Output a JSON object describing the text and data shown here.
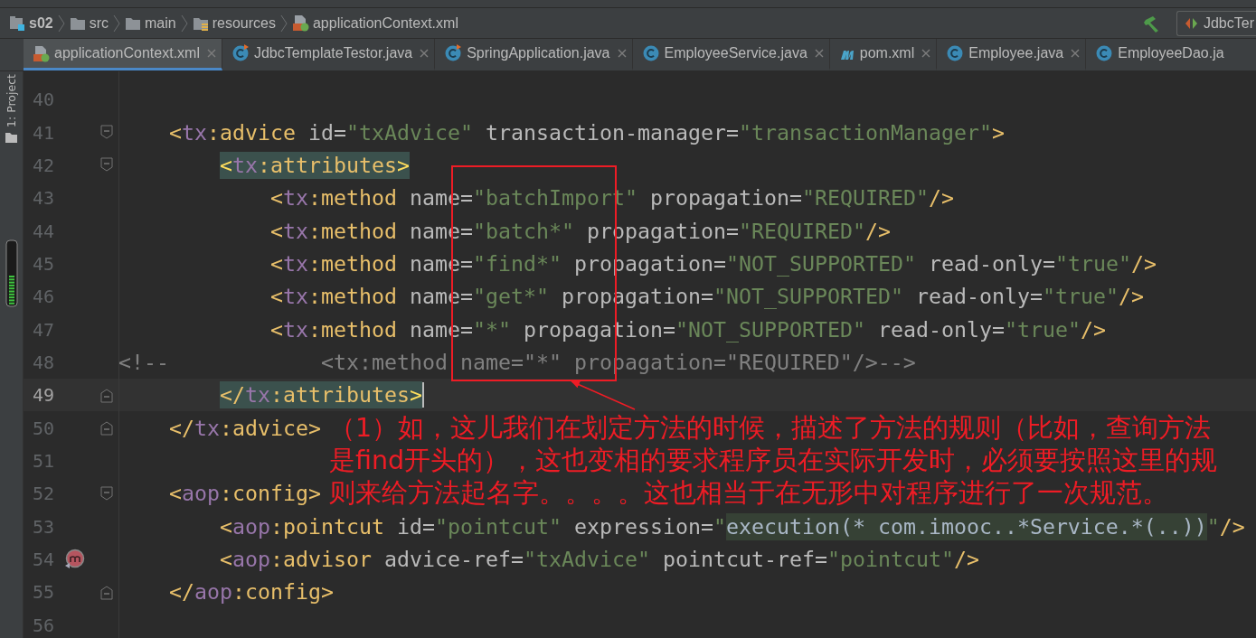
{
  "breadcrumbs": [
    {
      "label": "s02",
      "kind": "module"
    },
    {
      "label": "src",
      "kind": "folder"
    },
    {
      "label": "main",
      "kind": "folder"
    },
    {
      "label": "resources",
      "kind": "resources"
    },
    {
      "label": "applicationContext.xml",
      "kind": "xml"
    }
  ],
  "run_config": {
    "label": "JdbcTer"
  },
  "tool_window": {
    "label": "1: Project"
  },
  "tabs": [
    {
      "label": "applicationContext.xml",
      "kind": "xml",
      "selected": true,
      "closable": true
    },
    {
      "label": "JdbcTemplateTestor.java",
      "kind": "class-run",
      "selected": false,
      "closable": true
    },
    {
      "label": "SpringApplication.java",
      "kind": "class-run",
      "selected": false,
      "closable": true
    },
    {
      "label": "EmployeeService.java",
      "kind": "class",
      "selected": false,
      "closable": true
    },
    {
      "label": "pom.xml",
      "kind": "maven",
      "selected": false,
      "closable": true
    },
    {
      "label": "Employee.java",
      "kind": "class",
      "selected": false,
      "closable": true
    },
    {
      "label": "EmployeeDao.ja",
      "kind": "class",
      "selected": false,
      "closable": false
    }
  ],
  "lines": [
    {
      "number": "40"
    },
    {
      "number": "41",
      "fold_open": true,
      "tokens": [
        {
          "kind": "bracket",
          "text": "    <"
        },
        {
          "kind": "ns",
          "text": "tx"
        },
        {
          "kind": "name",
          "text": ":advice"
        },
        {
          "kind": "attr",
          "text": " id="
        },
        {
          "kind": "value",
          "text": "\"txAdvice\""
        },
        {
          "kind": "attr",
          "text": " transaction-manager="
        },
        {
          "kind": "value",
          "text": "\"transactionManager\""
        },
        {
          "kind": "bracket",
          "text": ">"
        }
      ]
    },
    {
      "number": "42",
      "fold_open": true,
      "tokens": [
        {
          "kind": "match-hl",
          "text": "        <"
        },
        {
          "kind": "match-ns",
          "text": "tx"
        },
        {
          "kind": "match-name",
          "text": ":attributes"
        },
        {
          "kind": "match-hl",
          "text": ">"
        }
      ]
    },
    {
      "number": "43",
      "tokens": [
        {
          "kind": "bracket",
          "text": "            <"
        },
        {
          "kind": "ns",
          "text": "tx"
        },
        {
          "kind": "name",
          "text": ":method"
        },
        {
          "kind": "attr",
          "text": " name="
        },
        {
          "kind": "value",
          "text": "\"batchImport\""
        },
        {
          "kind": "attr",
          "text": " propagation="
        },
        {
          "kind": "value",
          "text": "\"REQUIRED\""
        },
        {
          "kind": "bracket",
          "text": "/>"
        }
      ]
    },
    {
      "number": "44",
      "tokens": [
        {
          "kind": "bracket",
          "text": "            <"
        },
        {
          "kind": "ns",
          "text": "tx"
        },
        {
          "kind": "name",
          "text": ":method"
        },
        {
          "kind": "attr",
          "text": " name="
        },
        {
          "kind": "value",
          "text": "\"batch*\""
        },
        {
          "kind": "attr",
          "text": " propagation="
        },
        {
          "kind": "value",
          "text": "\"REQUIRED\""
        },
        {
          "kind": "bracket",
          "text": "/>"
        }
      ]
    },
    {
      "number": "45",
      "tokens": [
        {
          "kind": "bracket",
          "text": "            <"
        },
        {
          "kind": "ns",
          "text": "tx"
        },
        {
          "kind": "name",
          "text": ":method"
        },
        {
          "kind": "attr",
          "text": " name="
        },
        {
          "kind": "value",
          "text": "\"find*\""
        },
        {
          "kind": "attr",
          "text": " propagation="
        },
        {
          "kind": "value",
          "text": "\"NOT_SUPPORTED\""
        },
        {
          "kind": "attr",
          "text": " read-only="
        },
        {
          "kind": "value",
          "text": "\"true\""
        },
        {
          "kind": "bracket",
          "text": "/>"
        }
      ]
    },
    {
      "number": "46",
      "tokens": [
        {
          "kind": "bracket",
          "text": "            <"
        },
        {
          "kind": "ns",
          "text": "tx"
        },
        {
          "kind": "name",
          "text": ":method"
        },
        {
          "kind": "attr",
          "text": " name="
        },
        {
          "kind": "value",
          "text": "\"get*\""
        },
        {
          "kind": "attr",
          "text": " propagation="
        },
        {
          "kind": "value",
          "text": "\"NOT_SUPPORTED\""
        },
        {
          "kind": "attr",
          "text": " read-only="
        },
        {
          "kind": "value",
          "text": "\"true\""
        },
        {
          "kind": "bracket",
          "text": "/>"
        }
      ]
    },
    {
      "number": "47",
      "tokens": [
        {
          "kind": "bracket",
          "text": "            <"
        },
        {
          "kind": "ns",
          "text": "tx"
        },
        {
          "kind": "name",
          "text": ":method"
        },
        {
          "kind": "attr",
          "text": " name="
        },
        {
          "kind": "value",
          "text": "\"*\""
        },
        {
          "kind": "attr",
          "text": " propagation="
        },
        {
          "kind": "value",
          "text": "\"NOT_SUPPORTED\""
        },
        {
          "kind": "attr",
          "text": " read-only="
        },
        {
          "kind": "value",
          "text": "\"true\""
        },
        {
          "kind": "bracket",
          "text": "/>"
        }
      ]
    },
    {
      "number": "48",
      "tokens": [
        {
          "kind": "comment",
          "text": "<!--            <tx:method name=\"*\" propagation=\"REQUIRED\"/>-->"
        }
      ]
    },
    {
      "number": "49",
      "fold_close": true,
      "current": true,
      "tokens": [
        {
          "kind": "match-name",
          "text": "        </"
        },
        {
          "kind": "match-ns",
          "text": "tx"
        },
        {
          "kind": "match-name",
          "text": ":attributes"
        },
        {
          "kind": "match-hl",
          "text": ">"
        }
      ]
    },
    {
      "number": "50",
      "fold_close": true,
      "tokens": [
        {
          "kind": "bracket",
          "text": "    </"
        },
        {
          "kind": "ns",
          "text": "tx"
        },
        {
          "kind": "name",
          "text": ":advice"
        },
        {
          "kind": "bracket",
          "text": ">"
        }
      ]
    },
    {
      "number": "51"
    },
    {
      "number": "52",
      "fold_open": true,
      "tokens": [
        {
          "kind": "bracket",
          "text": "    <"
        },
        {
          "kind": "ns",
          "text": "aop"
        },
        {
          "kind": "name",
          "text": ":config"
        },
        {
          "kind": "bracket",
          "text": ">"
        }
      ]
    },
    {
      "number": "53",
      "tokens": [
        {
          "kind": "bracket",
          "text": "        <"
        },
        {
          "kind": "ns",
          "text": "aop"
        },
        {
          "kind": "name",
          "text": ":pointcut"
        },
        {
          "kind": "attr",
          "text": " id="
        },
        {
          "kind": "value",
          "text": "\"pointcut\""
        },
        {
          "kind": "attr",
          "text": " expression="
        },
        {
          "kind": "value",
          "text": "\""
        },
        {
          "kind": "injected",
          "text": "execution(* com.imooc..*Service.*(..))"
        },
        {
          "kind": "value",
          "text": "\""
        },
        {
          "kind": "bracket",
          "text": "/>"
        }
      ]
    },
    {
      "number": "54",
      "gutter_marker": true,
      "tokens": [
        {
          "kind": "bracket",
          "text": "        <"
        },
        {
          "kind": "ns",
          "text": "aop"
        },
        {
          "kind": "name",
          "text": ":advisor"
        },
        {
          "kind": "attr",
          "text": " advice-ref="
        },
        {
          "kind": "value",
          "text": "\"txAdvice\""
        },
        {
          "kind": "attr",
          "text": " pointcut-ref="
        },
        {
          "kind": "value",
          "text": "\"pointcut\""
        },
        {
          "kind": "bracket",
          "text": "/>"
        }
      ]
    },
    {
      "number": "55",
      "fold_close": true,
      "tokens": [
        {
          "kind": "bracket",
          "text": "    </"
        },
        {
          "kind": "ns",
          "text": "aop"
        },
        {
          "kind": "name",
          "text": ":config"
        },
        {
          "kind": "bracket",
          "text": ">"
        }
      ]
    },
    {
      "number": "56"
    }
  ],
  "annotation": {
    "text": "（1）如，这儿我们在划定方法的时候，描述了方法的规则（比如，查询方法是find开头的），这也变相的要求程序员在实际开发时，必须要按照这里的规则来给方法起名字。。。。这也相当于在无形中对程序进行了一次规范。"
  }
}
